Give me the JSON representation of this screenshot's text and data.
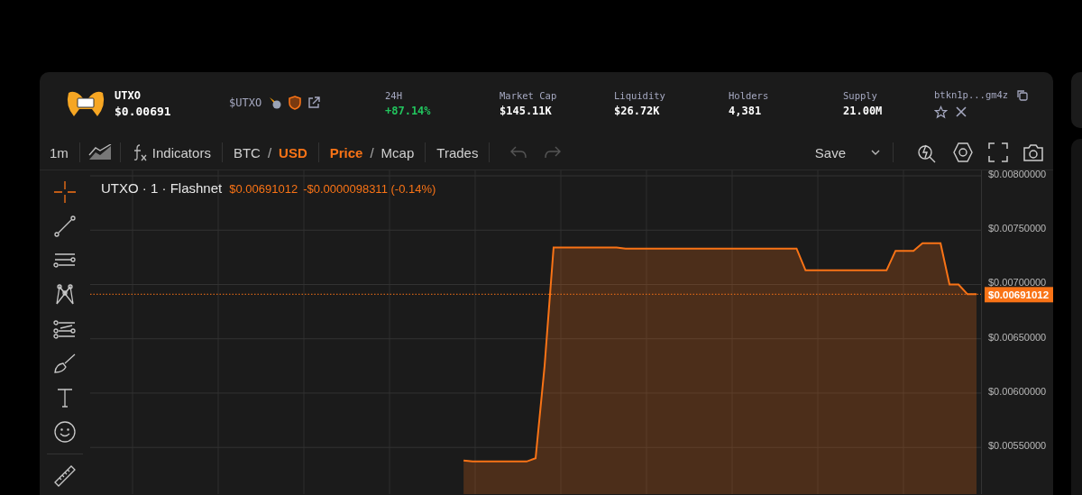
{
  "token": {
    "name": "UTXO",
    "price": "$0.00691",
    "symbol": "$UTXO"
  },
  "stats": [
    {
      "label": "24H",
      "value": "+87.14%",
      "kind": "change"
    },
    {
      "label": "Market Cap",
      "value": "$145.11K",
      "kind": "plain"
    },
    {
      "label": "Liquidity",
      "value": "$26.72K",
      "kind": "plain"
    },
    {
      "label": "Holders",
      "value": "4,381",
      "kind": "plain"
    },
    {
      "label": "Supply",
      "value": "21.00M",
      "kind": "plain"
    }
  ],
  "address": "btkn1p...gm4z",
  "toolbar": {
    "interval": "1m",
    "indicators": "Indicators",
    "currency": [
      {
        "label": "BTC",
        "selected": false
      },
      {
        "label": "USD",
        "selected": true
      }
    ],
    "mode": [
      {
        "label": "Price",
        "selected": true
      },
      {
        "label": "Mcap",
        "selected": false
      }
    ],
    "currency_separator": "/",
    "mode_separator": "/",
    "trades": "Trades",
    "save": "Save"
  },
  "drawing_tools": [
    {
      "kind": "crosshair",
      "selected": true
    },
    {
      "kind": "trend-line",
      "selected": false
    },
    {
      "kind": "lines",
      "selected": false
    },
    {
      "kind": "pattern",
      "selected": false
    },
    {
      "kind": "forecast",
      "selected": false
    },
    {
      "kind": "brush",
      "selected": false
    },
    {
      "kind": "text",
      "selected": false
    },
    {
      "kind": "emoji",
      "selected": false
    },
    {
      "kind": "ruler",
      "selected": false
    }
  ],
  "chart": {
    "legend": {
      "symbol": "UTXO · 1 · Flashnet",
      "price": "$0.00691012",
      "change": "-$0.0000098311 (-0.14%)"
    },
    "chart_data": {
      "type": "area",
      "grid": true,
      "ylim": [
        0.00507,
        0.00805
      ],
      "yticks": [
        {
          "value": 0.008,
          "label": "$0.00800000"
        },
        {
          "value": 0.0075,
          "label": "$0.00750000"
        },
        {
          "value": 0.007,
          "label": "$0.00700000"
        },
        {
          "value": 0.0065,
          "label": "$0.00650000"
        },
        {
          "value": 0.006,
          "label": "$0.00600000"
        },
        {
          "value": 0.0055,
          "label": "$0.00550000"
        }
      ],
      "series": [
        {
          "color": "#f97316",
          "values": [
            null,
            null,
            null,
            null,
            null,
            null,
            null,
            null,
            null,
            null,
            null,
            null,
            null,
            null,
            null,
            null,
            null,
            null,
            null,
            null,
            null,
            null,
            null,
            null,
            null,
            null,
            null,
            null,
            null,
            null,
            null,
            null,
            null,
            null,
            null,
            null,
            null,
            null,
            null,
            null,
            null,
            0.00538,
            0.00537,
            0.00537,
            0.00537,
            0.00537,
            0.00537,
            0.00537,
            0.00537,
            0.0054,
            0.00625,
            0.00734,
            0.00734,
            0.00734,
            0.00734,
            0.00734,
            0.00734,
            0.00734,
            0.00734,
            0.00733,
            0.00733,
            0.00733,
            0.00733,
            0.00733,
            0.00733,
            0.00733,
            0.00733,
            0.00733,
            0.00733,
            0.00733,
            0.00733,
            0.00733,
            0.00733,
            0.00733,
            0.00733,
            0.00733,
            0.00733,
            0.00733,
            0.00733,
            0.00713,
            0.00713,
            0.00713,
            0.00713,
            0.00713,
            0.00713,
            0.00713,
            0.00713,
            0.00713,
            0.00713,
            0.00731,
            0.00731,
            0.00731,
            0.00738,
            0.00738,
            0.00738,
            0.007,
            0.007,
            0.00691,
            0.00691
          ]
        }
      ],
      "ref_lines": [
        {
          "axis": "y",
          "value": 0.00691012
        }
      ],
      "annotations": [
        "$0.00691012"
      ]
    }
  }
}
